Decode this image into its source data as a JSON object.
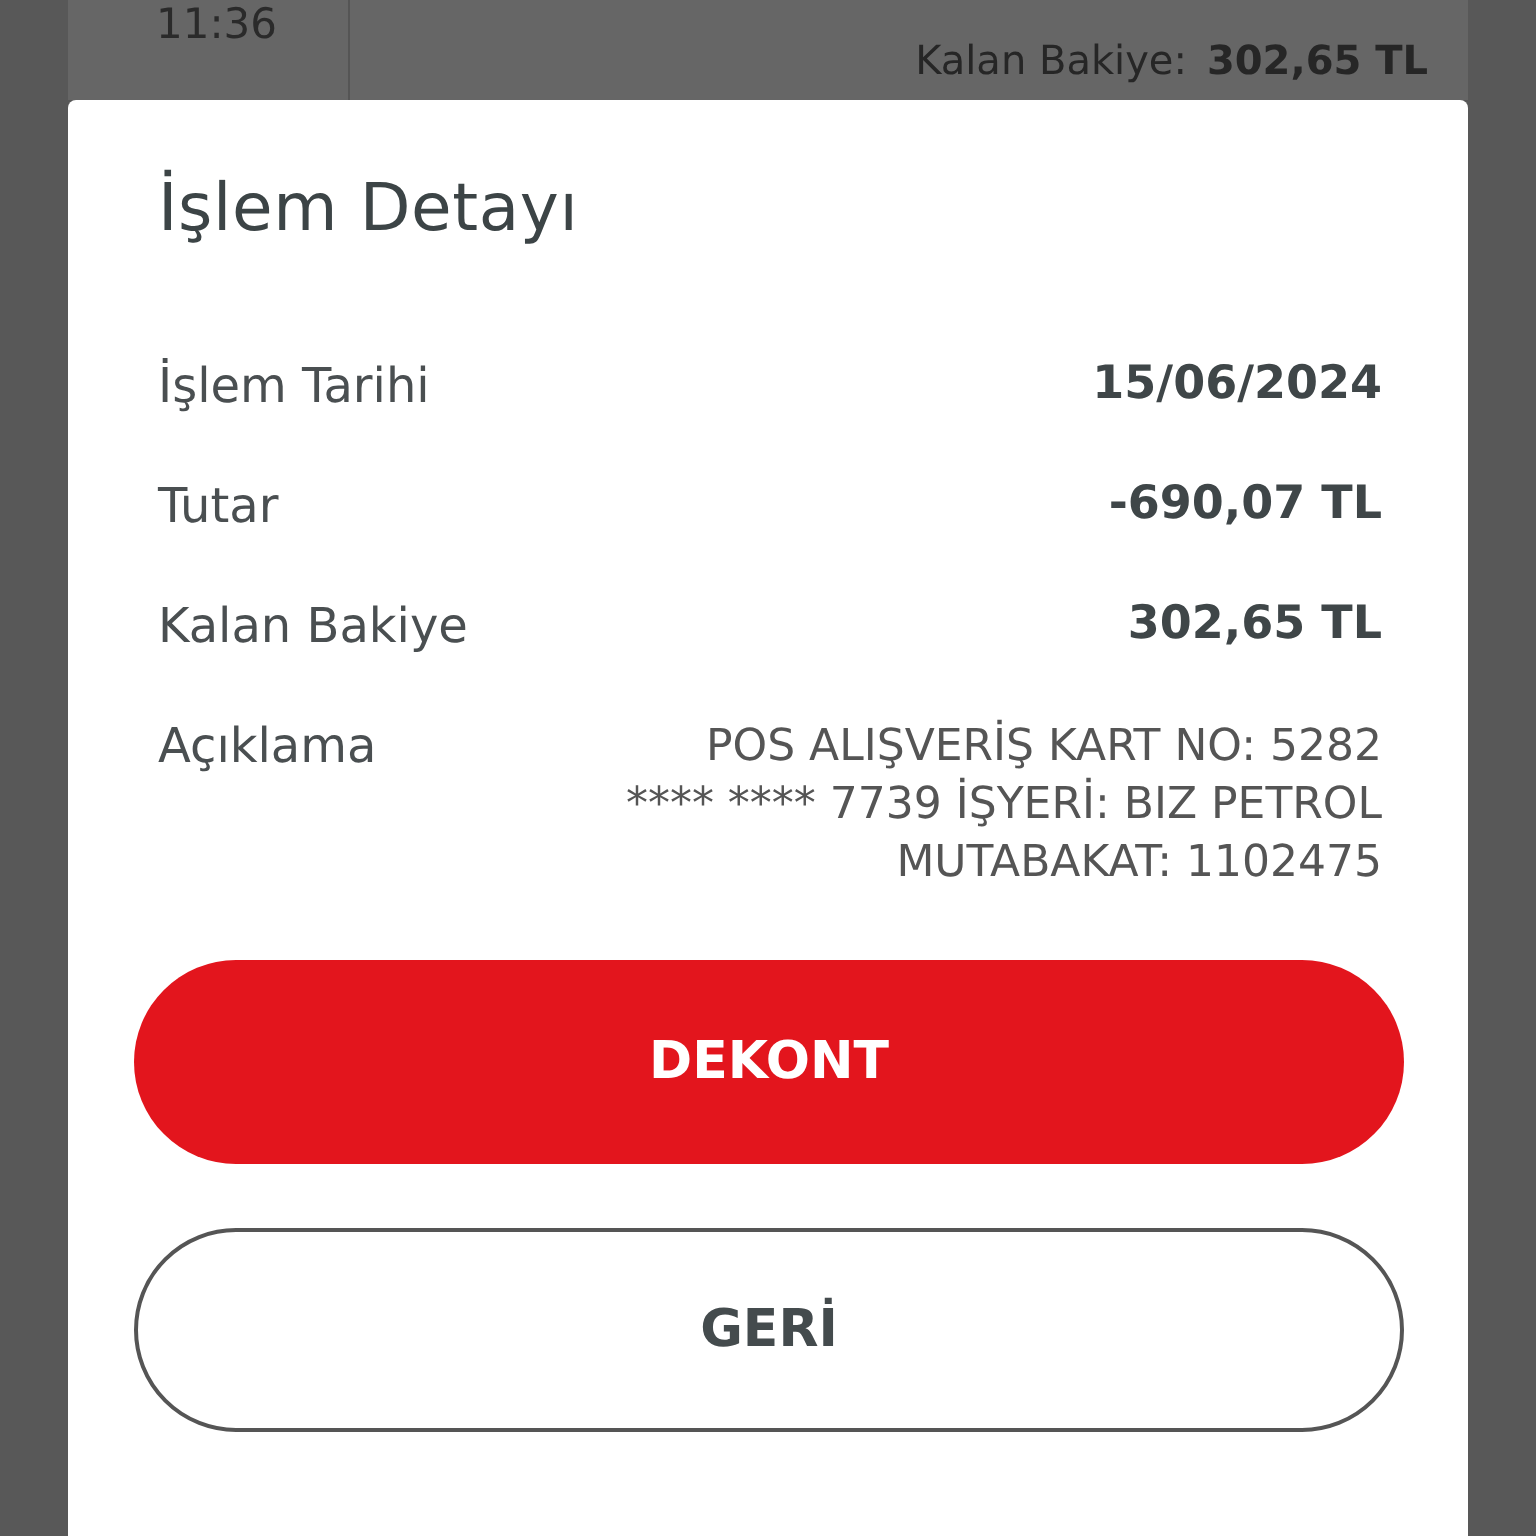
{
  "background": {
    "time": "11:36",
    "balance_label": "Kalan Bakiye:",
    "balance_value": "302,65 TL"
  },
  "dialog": {
    "title": "İşlem Detayı",
    "rows": [
      {
        "label": "İşlem Tarihi",
        "value": "15/06/2024",
        "kind": "bold"
      },
      {
        "label": "Tutar",
        "value": "-690,07 TL",
        "kind": "bold"
      },
      {
        "label": "Kalan Bakiye",
        "value": "302,65 TL",
        "kind": "bold"
      },
      {
        "label": "Açıklama",
        "value": "POS ALIŞVERİŞ KART NO: 5282\n**** **** 7739 İŞYERİ: BIZ PETROL\nMUTABAKAT: 1102475",
        "kind": "plain"
      }
    ],
    "buttons": [
      {
        "label": "DEKONT",
        "kind": "primary"
      },
      {
        "label": "GERİ",
        "kind": "outline"
      }
    ]
  }
}
